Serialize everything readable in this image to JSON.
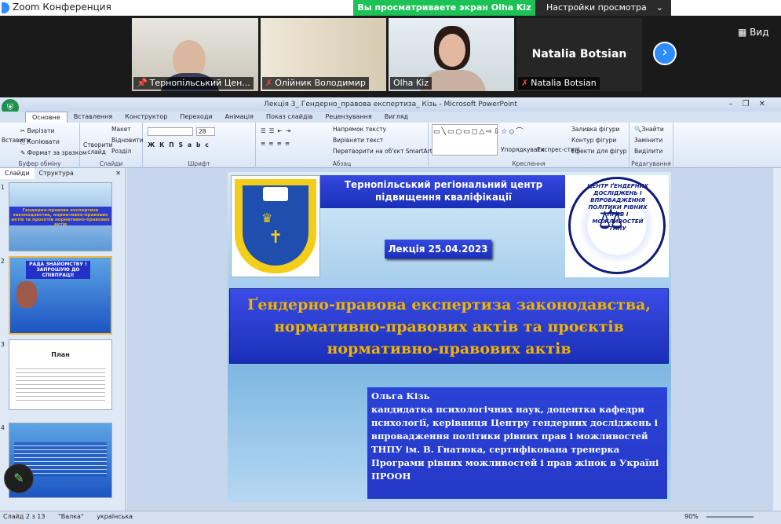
{
  "zoom": {
    "app_title": "Zoom Конференция",
    "viewing_banner": "Вы просматриваете экран Olha Kiz",
    "view_settings": "Настройки просмотра",
    "view_label": "Вид",
    "participants": [
      {
        "name": "Тернопільський Цен..."
      },
      {
        "name": "Олійник Володимир"
      },
      {
        "name": "Olha Kiz"
      },
      {
        "name": "Natalia Botsian"
      }
    ],
    "big_name": "Natalia Botsian"
  },
  "ppt": {
    "window_title": "Лекція 3_ Гендерно_правова експертиза_ Кізь - Microsoft PowerPoint",
    "tabs": [
      "Основне",
      "Вставлення",
      "Конструктор",
      "Переходи",
      "Анімація",
      "Показ слайдів",
      "Рецензування",
      "Вигляд"
    ],
    "ribbon": {
      "clipboard": {
        "label": "Буфер обміну",
        "paste": "Вставити",
        "cut": "Вирізати",
        "copy": "Копіювати",
        "format": "Формат за зразком"
      },
      "slides": {
        "label": "Слайди",
        "new": "Створити слайд",
        "layout": "Макет",
        "reset": "Відновити",
        "section": "Розділ"
      },
      "font": {
        "label": "Шрифт",
        "size": "28"
      },
      "paragraph": {
        "label": "Абзац",
        "direction": "Напрямок тексту",
        "align": "Вирівняти текст",
        "smartart": "Перетворити на об'єкт SmartArt"
      },
      "drawing": {
        "label": "Креслення",
        "arrange": "Упорядкувати",
        "styles": "Експрес-стилі",
        "fill": "Заливка фігури",
        "outline": "Контур фігури",
        "effects": "Ефекти для фігур"
      },
      "editing": {
        "label": "Редагування",
        "find": "Знайти",
        "replace": "Замінити",
        "select": "Виділити"
      }
    },
    "panel_tabs": [
      "Слайди",
      "Структура"
    ],
    "thumbs": [
      {
        "num": "1",
        "text": "Гендерно-правова експертиза законодавства, нормативно-правових актів та проєктів нормативно-правових актів"
      },
      {
        "num": "2",
        "text": "РАДА ЗНАЙОМСТВУ ! ЗАПРОШУЮ ДО СПІВПРАЦІ!"
      },
      {
        "num": "3",
        "text": "План"
      },
      {
        "num": "4",
        "text": ""
      }
    ],
    "status": {
      "slide": "Слайд 2 з 13",
      "theme": "\"Валка\"",
      "lang": "українська",
      "zoom": "90%"
    }
  },
  "slide": {
    "org": "Тернопільський регіональний центр підвищення кваліфікації",
    "lecture": "Лекція 25.04.2023",
    "title": "Ґендерно-правова експертиза законодавства, нормативно-правових актів та проєктів нормативно-правових актів",
    "author_name": "Ольга Кізь",
    "author_desc": "кандидатка психологічних наук,  доцентка кафедри психології, керівниця Центру гендерних досліджень і впровадження політики рівних прав і можливостей ТНПУ ім. В. Гнатюка, сертифікована тренерка Програми рівних можливостей і прав жінок в Україні  ПРООН",
    "seal_text": "ЦЕНТР ҐЕНДЕРНИХ ДОСЛІДЖЕНЬ І ВПРОВАДЖЕННЯ ПОЛІТИКИ РІВНИХ ПРАВ І МОЖЛИВОСТЕЙ ТНПУ"
  },
  "colors": {
    "zoom_green": "#1dc257",
    "slide_title": "#f0b400",
    "slide_bar": "#1a2fb8"
  }
}
